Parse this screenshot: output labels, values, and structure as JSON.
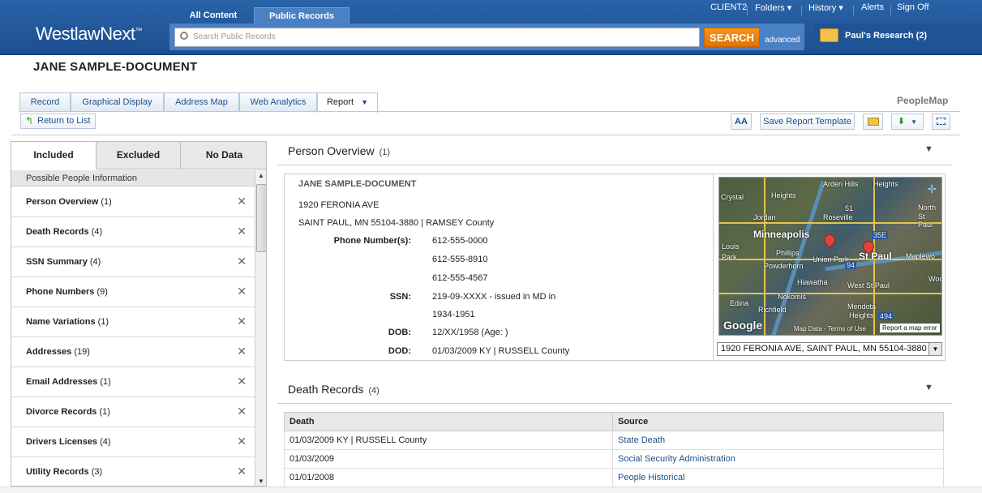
{
  "header": {
    "logo": "WestlawNext",
    "logo_mark": "™",
    "tabs": [
      {
        "label": "All Content"
      },
      {
        "label": "Public Records"
      }
    ],
    "search_placeholder": "Search Public Records",
    "search_button": "SEARCH",
    "advanced": "advanced",
    "nav": {
      "client": "CLIENT2",
      "folders": "Folders",
      "history": "History",
      "alerts": "Alerts",
      "signoff": "Sign Off"
    },
    "research": "Paul's Research (2)"
  },
  "doc_title": "JANE SAMPLE-DOCUMENT",
  "brand_right": "PeopleMap",
  "tabs": [
    {
      "label": "Record"
    },
    {
      "label": "Graphical Display"
    },
    {
      "label": "Address Map"
    },
    {
      "label": "Web Analytics"
    },
    {
      "label": "Report"
    }
  ],
  "toolbar": {
    "return": "Return to List",
    "font_size": "AA",
    "save_template": "Save Report Template"
  },
  "left_panel": {
    "tabs": [
      {
        "label": "Included"
      },
      {
        "label": "Excluded"
      },
      {
        "label": "No Data"
      }
    ],
    "subheader": "Possible People Information",
    "items": [
      {
        "label": "Person Overview",
        "count": "(1)"
      },
      {
        "label": "Death Records",
        "count": "(4)"
      },
      {
        "label": "SSN Summary",
        "count": "(4)"
      },
      {
        "label": "Phone Numbers",
        "count": "(9)"
      },
      {
        "label": "Name Variations",
        "count": "(1)"
      },
      {
        "label": "Addresses",
        "count": "(19)"
      },
      {
        "label": "Email Addresses",
        "count": "(1)"
      },
      {
        "label": "Divorce Records",
        "count": "(1)"
      },
      {
        "label": "Drivers Licenses",
        "count": "(4)"
      },
      {
        "label": "Utility Records",
        "count": "(3)"
      }
    ]
  },
  "overview": {
    "title": "Person Overview",
    "count": "(1)",
    "name": "JANE SAMPLE-DOCUMENT",
    "address1": "1920 FERONIA AVE",
    "address2": "SAINT PAUL, MN 55104-3880 | RAMSEY County",
    "phone_label": "Phone Number(s):",
    "phones": [
      "612-555-0000",
      "612-555-8910",
      "612-555-4567"
    ],
    "ssn_label": "SSN:",
    "ssn": "219-09-XXXX - issued in MD in",
    "ssn_years": "1934-1951",
    "dob_label": "DOB:",
    "dob": "12/XX/1958 (Age: )",
    "dod_label": "DOD:",
    "dod": "01/03/2009 KY | RUSSELL County",
    "map": {
      "labels": [
        "Crystal",
        "Heights",
        "Arden Hills",
        "Heights",
        "Jordan",
        "Roseville",
        "North",
        "St Paul",
        "Minneapolis",
        "Louis",
        "Park",
        "Phillips",
        "Powderhorn",
        "Union Park",
        "St Paul",
        "Maplewo",
        "Hiawatha",
        "West St Paul",
        "Woo",
        "Nokomis",
        "Edina",
        "Richfield",
        "Mendota",
        "Heights",
        "35E",
        "51",
        "94",
        "494"
      ],
      "attribution": "Map Data - Terms of Use",
      "error_link": "Report a map error",
      "google": "Google",
      "select_value": "1920 FERONIA AVE, SAINT PAUL, MN 55104-3880 |"
    }
  },
  "death": {
    "title": "Death Records",
    "count": "(4)",
    "columns": [
      "Death",
      "Source"
    ],
    "rows": [
      {
        "death": "01/03/2009 KY | RUSSELL County",
        "source": "State Death"
      },
      {
        "death": "01/03/2009",
        "source": "Social Security Administration"
      },
      {
        "death": "01/01/2008",
        "source": "People Historical"
      }
    ]
  },
  "colors": {
    "header_blue": "#1c4f8f",
    "search_orange": "#f7941d",
    "link_blue": "#1d4f89"
  }
}
